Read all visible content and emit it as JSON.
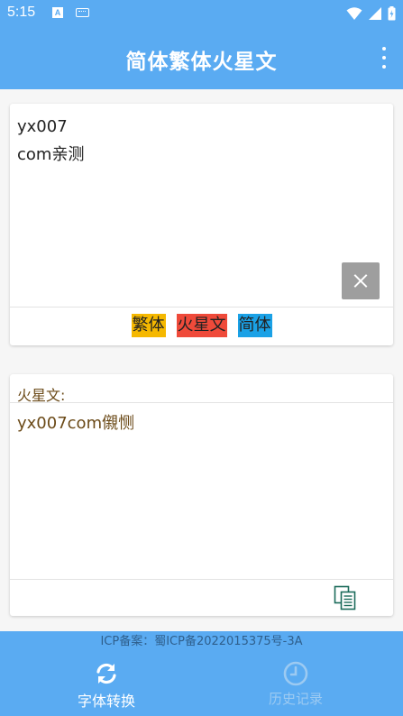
{
  "status_bar": {
    "time": "5:15",
    "a_icon_letter": "A"
  },
  "app_bar": {
    "title": "简体繁体火星文"
  },
  "input_card": {
    "text": "yx007\ncom亲测",
    "buttons": {
      "traditional": "繁体",
      "martian": "火星文",
      "simplified": "简体"
    }
  },
  "output_card": {
    "label": "火星文:",
    "text": "yx007com儭恻"
  },
  "icp_bar": {
    "text": "ICP备案：蜀ICP备2022015375号-3A"
  },
  "bottom_nav": {
    "convert_label": "字体转换",
    "history_label": "历史记录"
  },
  "colors": {
    "primary": "#5aabf2",
    "traditional_btn": "#f5b800",
    "martian_btn": "#ef4a3a",
    "simplified_btn": "#1aa1e6",
    "output_text": "#6b4a18"
  },
  "icons": [
    "wifi-icon",
    "signal-icon",
    "battery-icon",
    "more-vert-icon",
    "close-icon",
    "copy-icon",
    "swap-icon",
    "clock-icon"
  ]
}
